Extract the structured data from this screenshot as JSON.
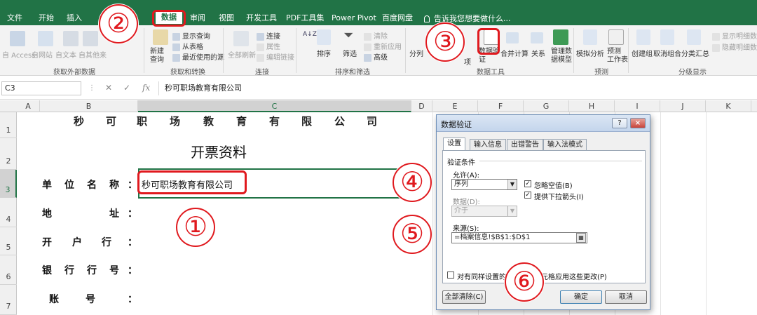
{
  "ribbon_tabs": [
    "文件",
    "开始",
    "插入",
    "数据",
    "审阅",
    "视图",
    "开发工具",
    "PDF工具集",
    "Power Pivot",
    "百度网盘"
  ],
  "tell_me": "告诉我您想要做什么...",
  "ribbon": {
    "get_external": {
      "items": [
        "自 Access",
        "自网站",
        "自文本",
        "自其他来"
      ],
      "group_label": "获取外部数据"
    },
    "get_transform": {
      "new_query": "新建\n查询",
      "show_queries": "显示查询",
      "from_table": "从表格",
      "recent_sources": "最近使用的源",
      "group_label": "获取和转换"
    },
    "connections": {
      "refresh_all": "全部刷新",
      "connections": "连接",
      "properties": "属性",
      "edit_links": "编辑链接",
      "group_label": "连接"
    },
    "sort_filter": {
      "sort": "排序",
      "filter": "筛选",
      "clear": "清除",
      "reapply": "重新应用",
      "advanced": "高级",
      "group_label": "排序和筛选"
    },
    "data_tools": {
      "text_to_columns": "分列",
      "remove_dup": "项",
      "data_validation": "数据验\n证",
      "consolidate": "合并计算",
      "relationships": "关系",
      "data_model": "管理数\n据模型",
      "group_label": "数据工具"
    },
    "forecast": {
      "what_if": "模拟分析",
      "forecast_sheet": "预测\n工作表",
      "group_label": "预测"
    },
    "outline": {
      "group": "创建组",
      "ungroup": "取消组合",
      "subtotal": "分类汇总",
      "show_detail": "显示明细数据",
      "hide_detail": "隐藏明细数据",
      "group_label": "分级显示"
    }
  },
  "formula_bar": {
    "name_box": "C3",
    "fx": "fx",
    "value": "秒可职场教育有限公司"
  },
  "columns": [
    "A",
    "B",
    "C",
    "D",
    "E",
    "F",
    "G",
    "H",
    "I",
    "J",
    "K"
  ],
  "rows": [
    "1",
    "2",
    "3",
    "4",
    "5",
    "6",
    "7"
  ],
  "sheet": {
    "company_chars": [
      "秒",
      "可",
      "职",
      "场",
      "教",
      "育",
      "有",
      "限",
      "公",
      "司"
    ],
    "title": "开票资料",
    "labels": [
      {
        "chars": [
          "单",
          "位",
          "名",
          "称"
        ],
        "colon": "："
      },
      {
        "chars": [
          "地",
          "址"
        ],
        "colon": "："
      },
      {
        "chars": [
          "开",
          "户",
          "行"
        ],
        "colon": "："
      },
      {
        "chars": [
          "银",
          "行",
          "行",
          "号"
        ],
        "colon": "："
      },
      {
        "chars": [
          "账",
          "号"
        ],
        "colon": "："
      }
    ],
    "c3_value": "秒可职场教育有限公司"
  },
  "steps": [
    "②",
    "③",
    "④",
    "①",
    "⑤",
    "⑥"
  ],
  "dialog": {
    "title": "数据验证",
    "help": "?",
    "close": "×",
    "tabs": [
      "设置",
      "输入信息",
      "出错警告",
      "输入法模式"
    ],
    "section": "验证条件",
    "allow_label": "允许(A):",
    "allow_value": "序列",
    "ignore_blank": "忽略空值(B)",
    "dropdown": "提供下拉箭头(I)",
    "data_label": "数据(D):",
    "data_value": "介于",
    "source_label": "来源(S):",
    "source_value": "=档案信息!$B$1:$D$1",
    "apply_all": "对有同样设置的所有其他单元格应用这些更改(P)",
    "clear_all": "全部清除(C)",
    "ok": "确定",
    "cancel": "取消"
  },
  "colors": {
    "excel_green": "#217346",
    "highlight_red": "#e0191e"
  }
}
